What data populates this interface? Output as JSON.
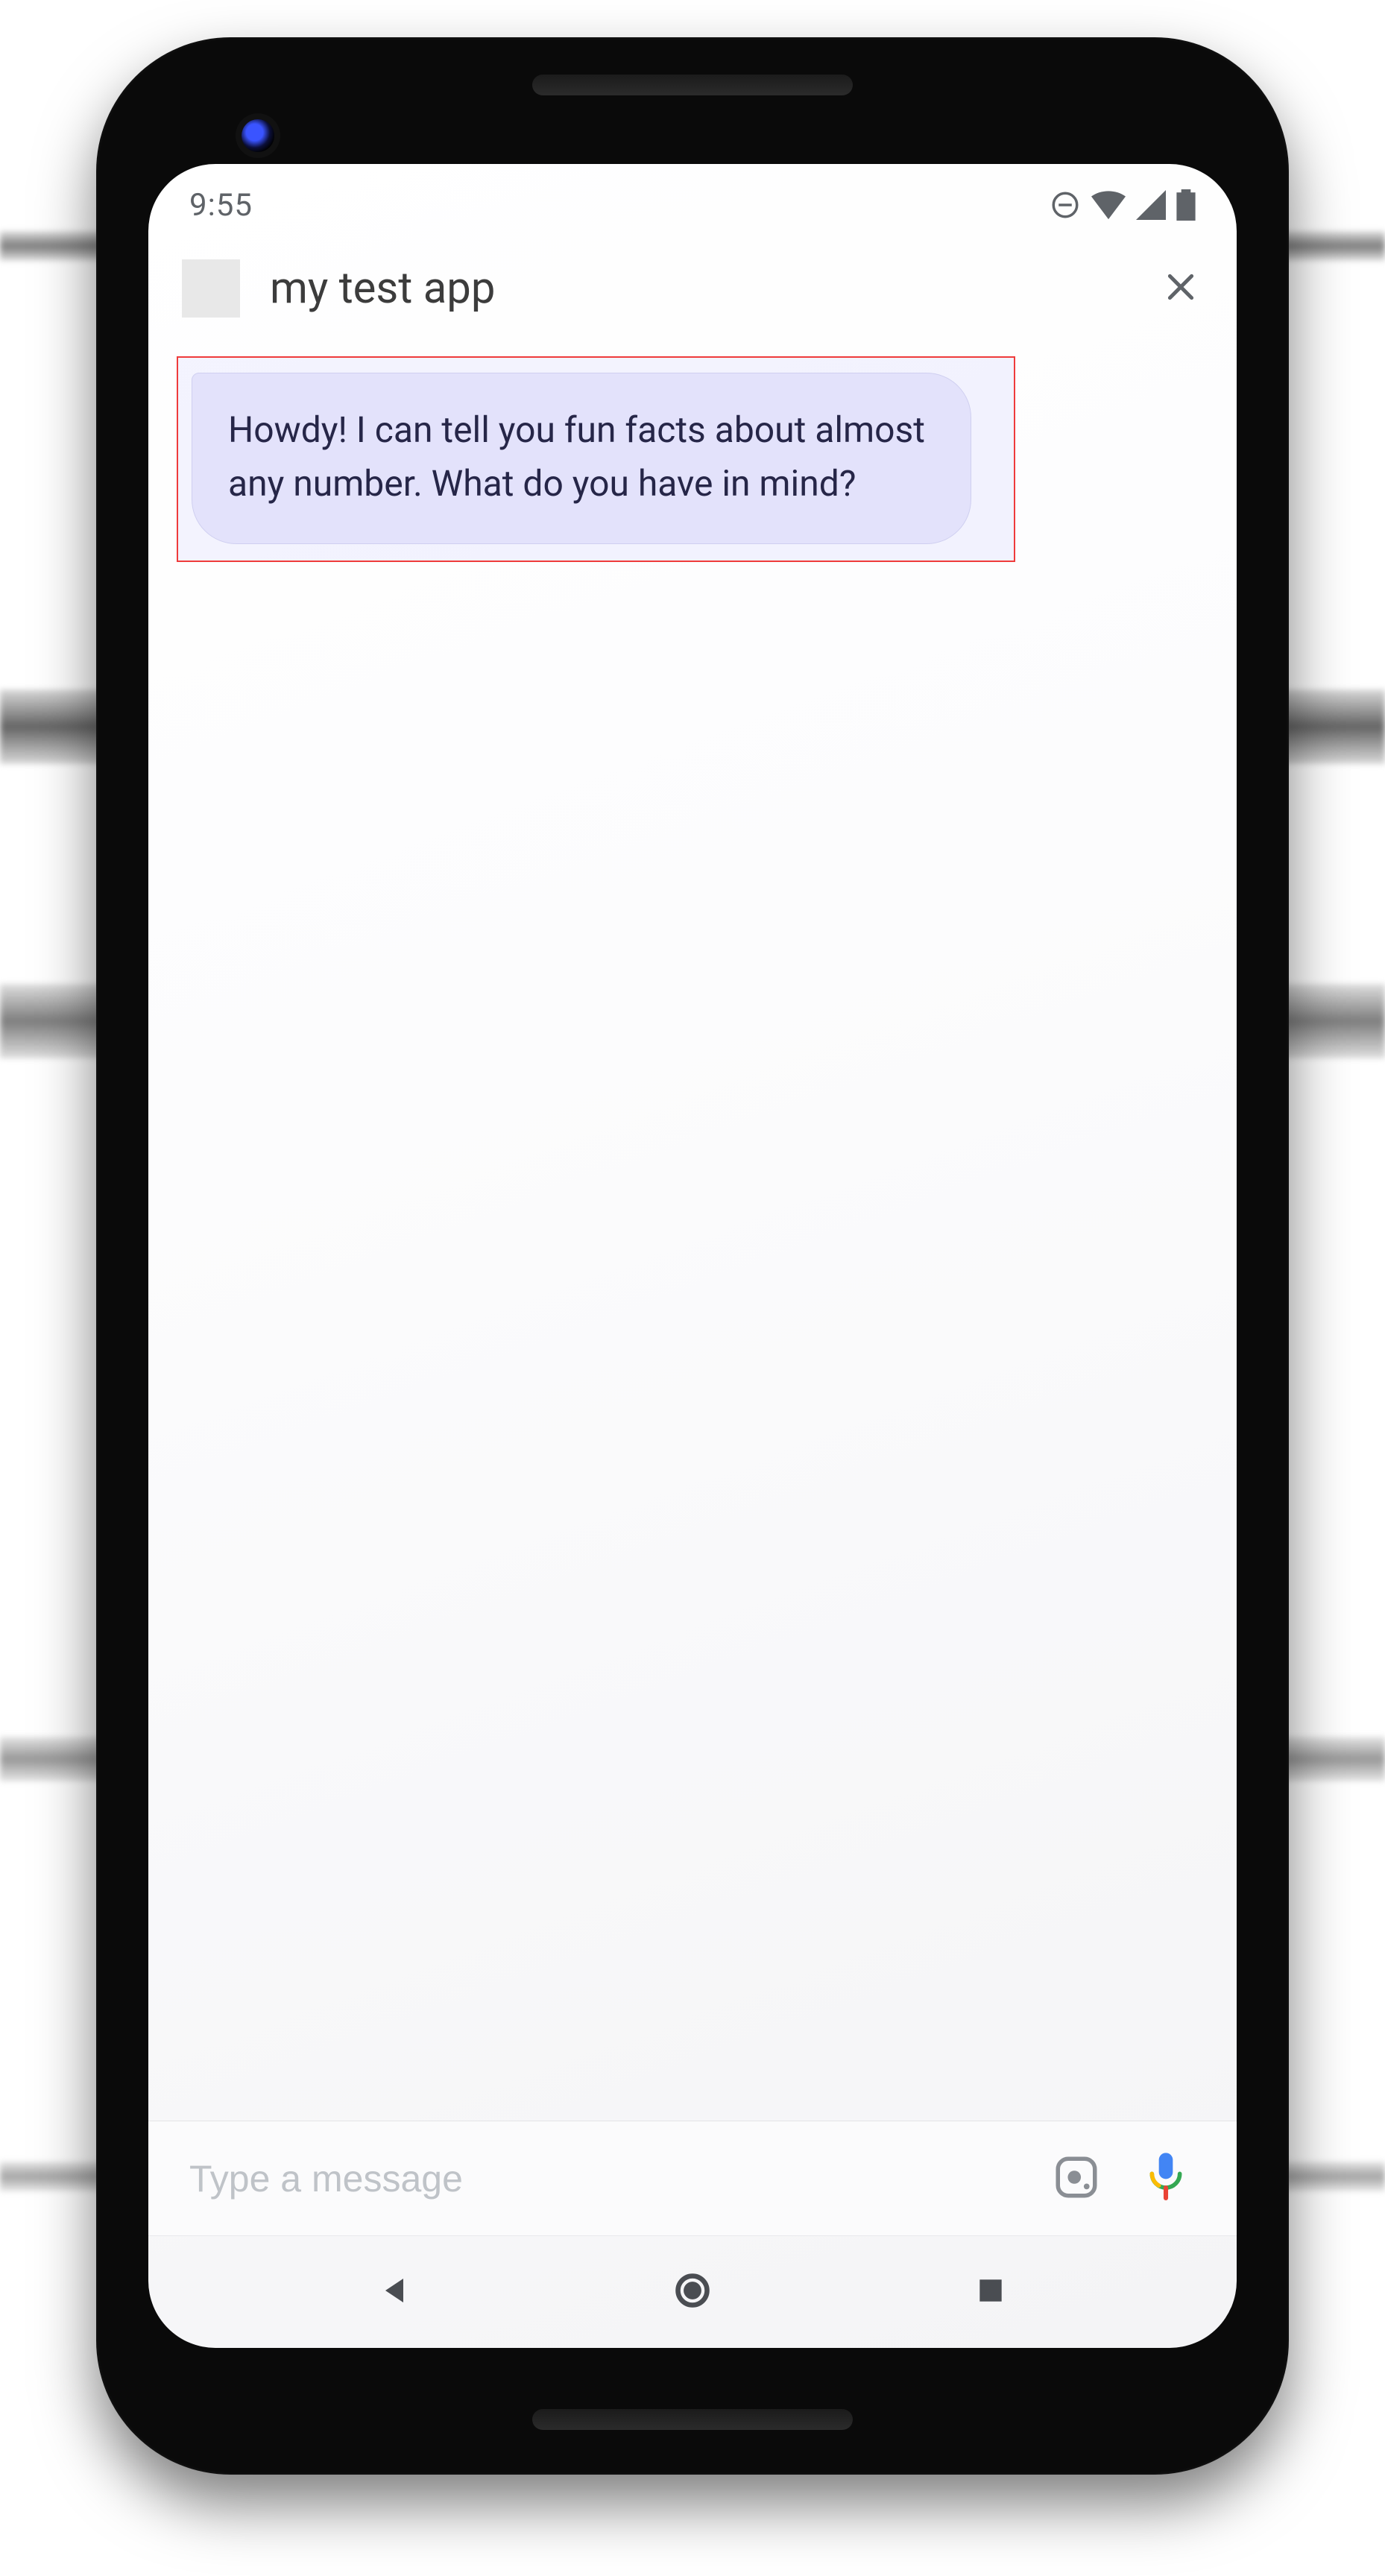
{
  "status": {
    "time": "9:55"
  },
  "header": {
    "title": "my test app"
  },
  "chat": {
    "messages": [
      {
        "text": "Howdy! I can tell you fun facts about almost any number. What do you have in mind?"
      }
    ]
  },
  "input": {
    "placeholder": "Type a message"
  },
  "colors": {
    "bubble_bg": "#e3e2fb",
    "highlight_border": "#ef3b3b"
  }
}
